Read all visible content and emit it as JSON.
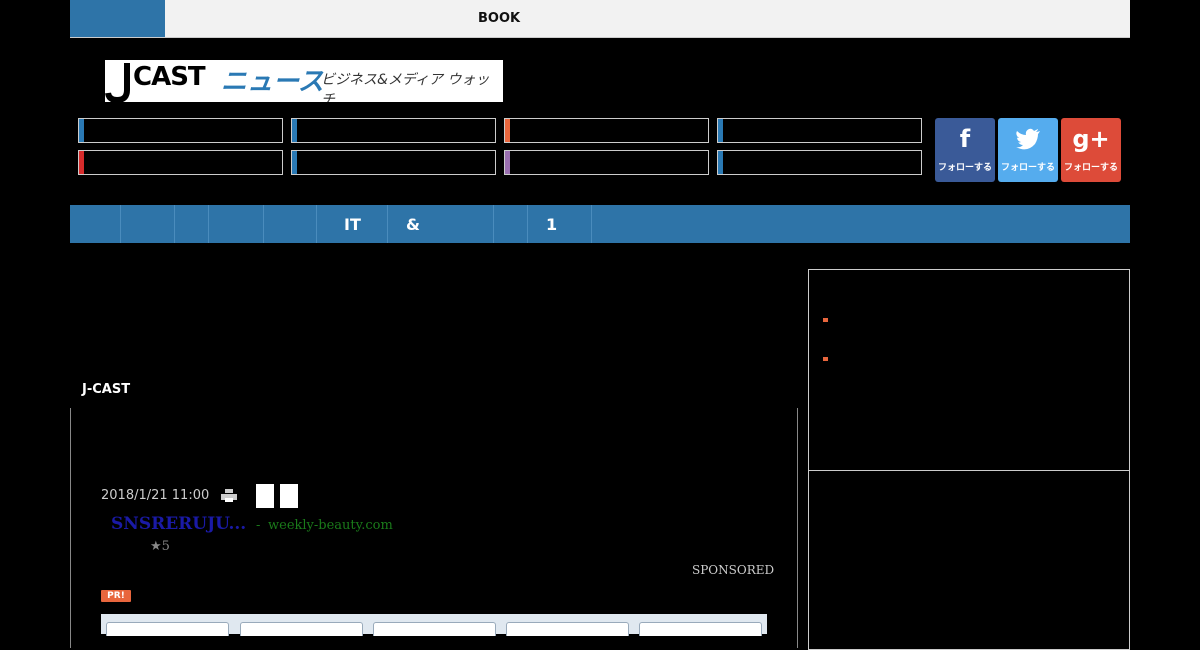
{
  "topbar": {
    "book_label": "BOOK"
  },
  "logo": {
    "jcast": "CAST",
    "news": "ニュース",
    "tagline": "ビジネス&メディア ウォッチ"
  },
  "categories": {
    "stripe_colors": [
      "#2a79b4",
      "#2a79b4",
      "#e8663d",
      "#2a79b4",
      "#d62b2b",
      "#2a79b4",
      "#9a6fb0",
      "#2a79b4"
    ]
  },
  "follow": {
    "facebook": {
      "icon": "f",
      "label": "フォローする",
      "color": "#3a5a98"
    },
    "twitter": {
      "icon": "twitter-bird",
      "label": "フォローする",
      "color": "#55acee"
    },
    "googleplus": {
      "icon": "g+",
      "label": "フォローする",
      "color": "#dd4b39"
    }
  },
  "nav": {
    "items": [
      "",
      "",
      "",
      "",
      "",
      "IT",
      "&",
      "",
      "1"
    ]
  },
  "main": {
    "section_label": "J-CAST",
    "date": "2018/1/21 11:00",
    "ad": {
      "title": "SNSRERUJU...",
      "separator": "-",
      "domain": "weekly-beauty.com",
      "rating": "★5"
    },
    "sponsored_label": "SPONSORED",
    "pr_label": "PR!"
  },
  "colors": {
    "nav_blue": "#2e74a8",
    "accent_orange": "#e8663d"
  }
}
